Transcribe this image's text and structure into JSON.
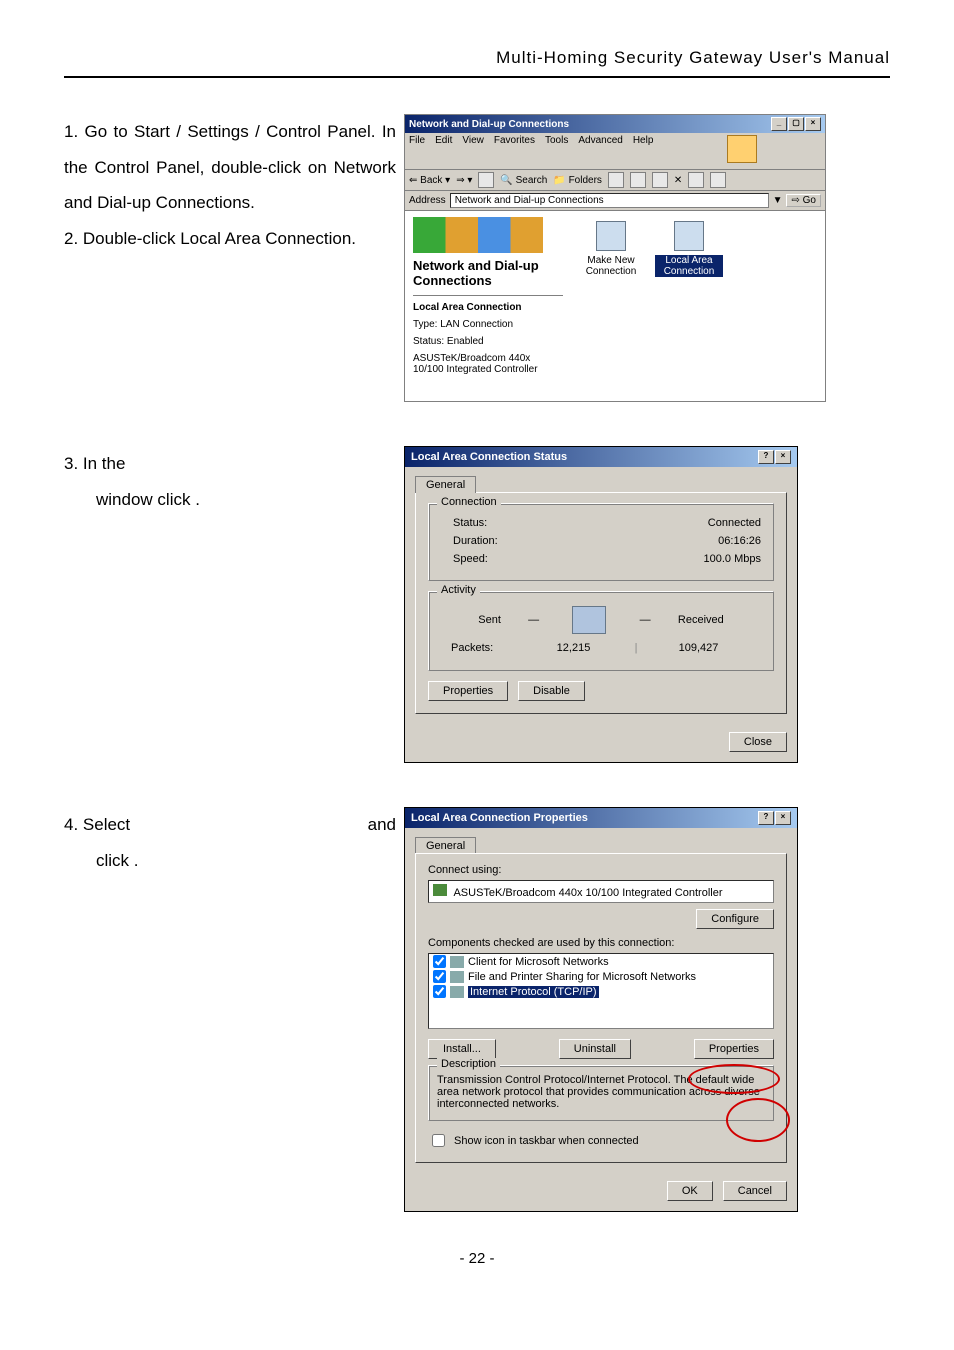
{
  "header": {
    "title": "Multi-Homing Security Gateway User's Manual"
  },
  "steps": {
    "s1": "1.   Go to Start / Settings / Control Panel. In the Control Panel, double-click on Network and Dial-up Connections.",
    "s2": "2.   Double-click Local Area Connection.",
    "s3a": "3.   In the ",
    "s3b": "window click              .",
    "s4a": "4.   Select",
    "s4b": "and",
    "s4c": "click              ."
  },
  "footer": {
    "page": "- 22 -"
  },
  "explorer": {
    "title": "Network and Dial-up Connections",
    "menu": [
      "File",
      "Edit",
      "View",
      "Favorites",
      "Tools",
      "Advanced",
      "Help"
    ],
    "toolbar": {
      "back": "Back",
      "search": "Search",
      "folders": "Folders"
    },
    "addr_label": "Address",
    "addr_value": "Network and Dial-up Connections",
    "go": "Go",
    "side_title": "Network and Dial-up Connections",
    "side_section": "Local Area Connection",
    "side_type": "Type: LAN Connection",
    "side_status": "Status: Enabled",
    "side_device": "ASUSTeK/Broadcom 440x 10/100 Integrated Controller",
    "icons": {
      "make_new": "Make New Connection",
      "lac": "Local Area Connection"
    }
  },
  "status_dlg": {
    "title": "Local Area Connection Status",
    "tab": "General",
    "conn_legend": "Connection",
    "status_k": "Status:",
    "status_v": "Connected",
    "dur_k": "Duration:",
    "dur_v": "06:16:26",
    "speed_k": "Speed:",
    "speed_v": "100.0 Mbps",
    "act_legend": "Activity",
    "sent": "Sent",
    "received": "Received",
    "packets_k": "Packets:",
    "packets_sent": "12,215",
    "packets_recv": "109,427",
    "btn_props": "Properties",
    "btn_disable": "Disable",
    "btn_close": "Close"
  },
  "props_dlg": {
    "title": "Local Area Connection Properties",
    "tab": "General",
    "connect_using": "Connect using:",
    "device": "ASUSTeK/Broadcom 440x 10/100 Integrated Controller",
    "btn_configure": "Configure",
    "components_label": "Components checked are used by this connection:",
    "items": [
      "Client for Microsoft Networks",
      "File and Printer Sharing for Microsoft Networks",
      "Internet Protocol (TCP/IP)"
    ],
    "btn_install": "Install...",
    "btn_uninstall": "Uninstall",
    "btn_props": "Properties",
    "desc_legend": "Description",
    "desc_text": "Transmission Control Protocol/Internet Protocol. The default wide area network protocol that provides communication across diverse interconnected networks.",
    "show_icon": "Show icon in taskbar when connected",
    "btn_ok": "OK",
    "btn_cancel": "Cancel"
  }
}
